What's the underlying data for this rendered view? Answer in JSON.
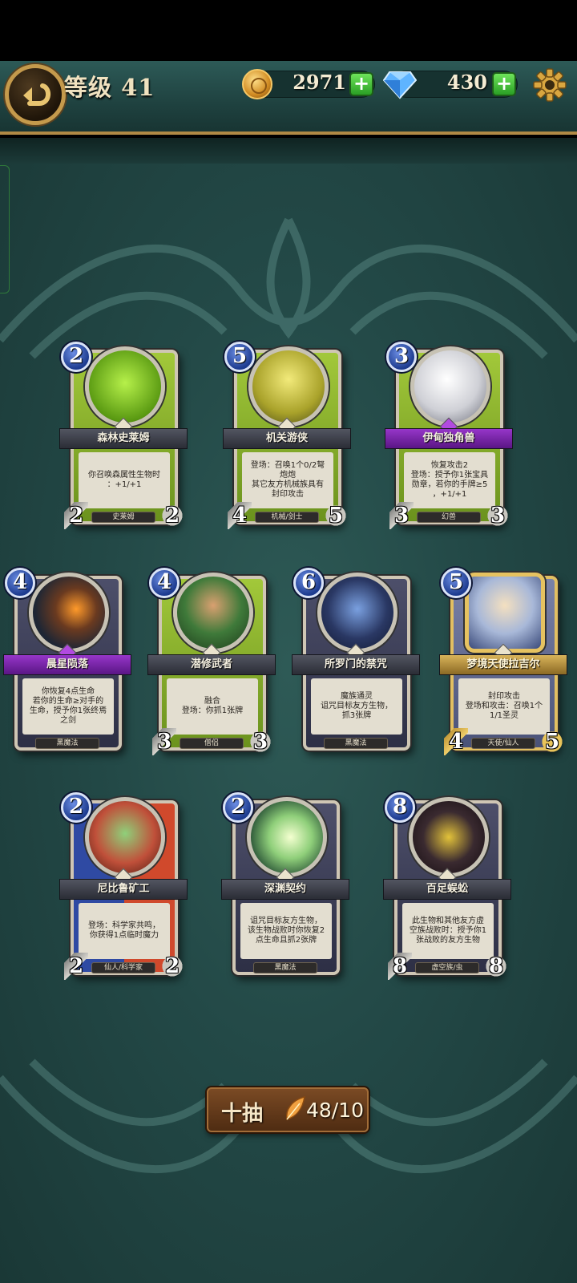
{
  "header": {
    "level_label": "等级 41",
    "coins": "2971",
    "gems": "430",
    "plus_label": "+"
  },
  "cards": [
    {
      "name": "森林史莱姆",
      "cost": "2",
      "text": "你召唤森属性生物时\n：+1/+1",
      "type": "史莱姆",
      "attack": "2",
      "health": "2",
      "style": "green",
      "banner": "",
      "art": "#7fcf2a"
    },
    {
      "name": "机关游侠",
      "cost": "5",
      "text": "登场：召唤1个0/2弩\n炮炮\n其它友方机械族具有\n封印攻击",
      "type": "机械/剑士",
      "attack": "4",
      "health": "5",
      "style": "green",
      "banner": "",
      "art": "#c8c23a"
    },
    {
      "name": "伊甸独角兽",
      "cost": "3",
      "text": "恢复攻击2\n登场：授予你1张宝具\n勋章，若你的手牌≥5\n，+1/+1",
      "type": "幻兽",
      "attack": "3",
      "health": "3",
      "style": "green",
      "banner": "purple",
      "art": "#d8d8dc"
    },
    {
      "name": "晨星陨落",
      "cost": "4",
      "text": "你恢复4点生命\n若你的生命≥对手的\n生命，授予你1张终焉\n之剑",
      "type": "黑魔法",
      "attack": "",
      "health": "",
      "style": "dark",
      "banner": "purple",
      "art": "#2c3444"
    },
    {
      "name": "潜修武者",
      "cost": "4",
      "text": "融合\n登场：你抓1张牌",
      "type": "僧侣",
      "attack": "3",
      "health": "3",
      "style": "green",
      "banner": "",
      "art": "#3f7a3a"
    },
    {
      "name": "所罗门的禁咒",
      "cost": "6",
      "text": "魔族通灵\n诅咒目标友方生物，\n抓3张牌",
      "type": "黑魔法",
      "attack": "",
      "health": "",
      "style": "dark",
      "banner": "",
      "art": "#2a3864"
    },
    {
      "name": "梦境天使拉吉尔",
      "cost": "5",
      "text": "封印攻击\n登场和攻击：召唤1个\n1/1圣灵",
      "type": "天使/仙人",
      "attack": "4",
      "health": "5",
      "style": "gold",
      "banner": "golden",
      "art": "#a8b8d8"
    },
    {
      "name": "尼比鲁矿工",
      "cost": "2",
      "text": "登场：科学家共鸣，\n你获得1点临时魔力",
      "type": "仙人/科学家",
      "attack": "2",
      "health": "2",
      "style": "split",
      "banner": "",
      "art": "#c0503a"
    },
    {
      "name": "深渊契约",
      "cost": "2",
      "text": "诅咒目标友方生物，\n该生物战败时你恢复2\n点生命且抓2张牌",
      "type": "黑魔法",
      "attack": "",
      "health": "",
      "style": "dark",
      "banner": "",
      "art": "#8fcf7a"
    },
    {
      "name": "百足蜈蚣",
      "cost": "8",
      "text": "此生物和其他友方虚\n空族战败时：授予你1\n张战败的友方生物",
      "type": "虚空族/虫",
      "attack": "8",
      "health": "8",
      "style": "dark",
      "banner": "",
      "art": "#3a2a30"
    }
  ],
  "draw": {
    "label": "十抽",
    "count": "48/10"
  },
  "colors": {
    "accent_gold": "#c49a4c",
    "plus_green": "#3fbf32",
    "board_teal": "#234947"
  },
  "icons": [
    "back-arrow-icon",
    "coin-icon",
    "gem-icon",
    "gear-icon",
    "feather-icon"
  ]
}
